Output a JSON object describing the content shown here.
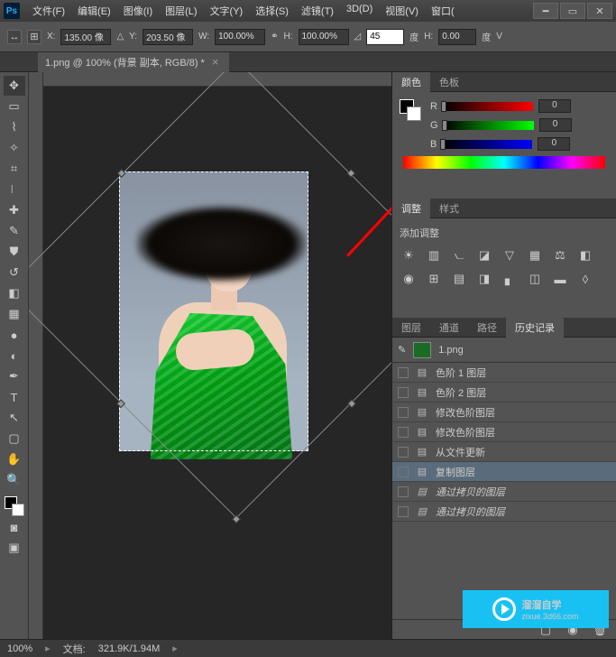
{
  "menu": [
    "文件(F)",
    "编辑(E)",
    "图像(I)",
    "图层(L)",
    "文字(Y)",
    "选择(S)",
    "滤镜(T)",
    "3D(D)",
    "视图(V)",
    "窗口("
  ],
  "options": {
    "x_lbl": "X:",
    "x": "135.00 像",
    "y_lbl": "Y:",
    "y": "203.50 像",
    "w_lbl": "W:",
    "w": "100.00%",
    "h_lbl": "H:",
    "h": "100.00%",
    "ang": "45",
    "ang_unit": "度",
    "h2_lbl": "H:",
    "h2": "0.00",
    "h2_unit": "度",
    "v_lbl": "V"
  },
  "doctab": "1.png @ 100% (背景 副本, RGB/8) *",
  "panels": {
    "color_tab": "颜色",
    "swatch_tab": "色板",
    "r": "R",
    "g": "G",
    "b": "B",
    "val": "0",
    "adjust_tab": "调整",
    "styles_tab": "样式",
    "add_adjust": "添加调整",
    "layers": "图层",
    "channels": "通道",
    "paths": "路径",
    "history": "历史记录"
  },
  "hist_top": "1.png",
  "history": [
    {
      "t": "色阶 1 图层"
    },
    {
      "t": "色阶 2 图层"
    },
    {
      "t": "修改色阶图层"
    },
    {
      "t": "修改色阶图层"
    },
    {
      "t": "从文件更新"
    },
    {
      "t": "复制图层",
      "on": true
    },
    {
      "t": "通过拷贝的图层",
      "dim": true
    },
    {
      "t": "通过拷贝的图层",
      "dim": true
    }
  ],
  "status": {
    "zoom": "100%",
    "doc_lbl": "文档:",
    "doc": "321.9K/1.94M"
  },
  "watermark": {
    "brand": "溜溜自学",
    "url": "zixue.3d66.com"
  }
}
